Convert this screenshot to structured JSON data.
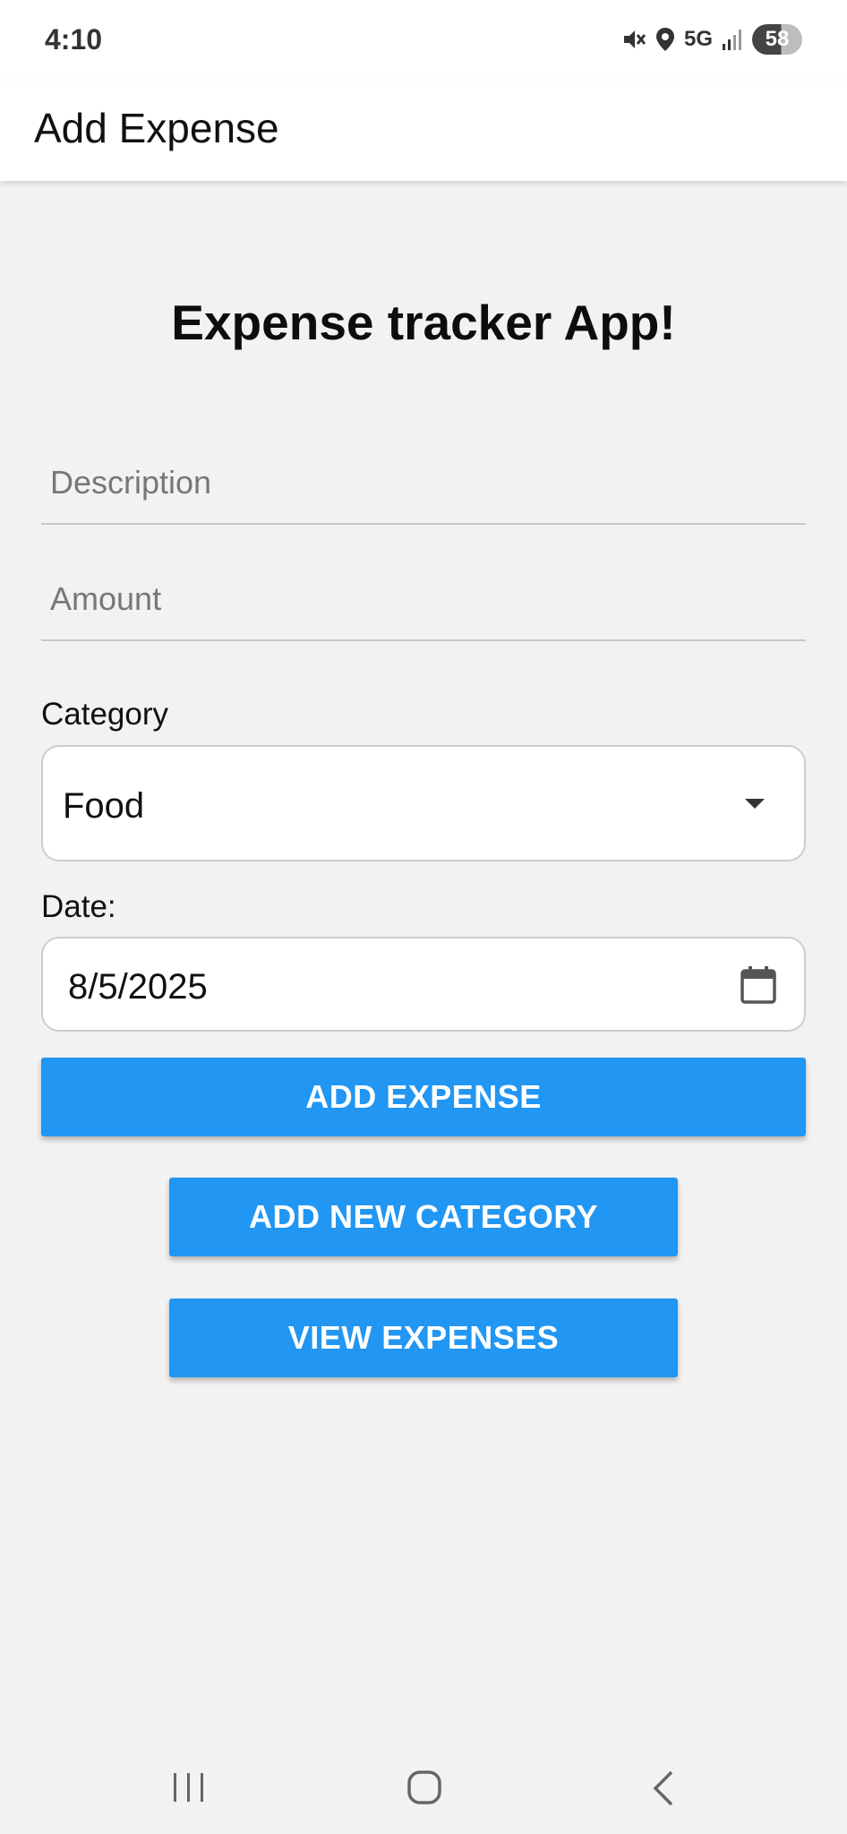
{
  "status_bar": {
    "time": "4:10",
    "network": "5G",
    "battery": "58",
    "icons": [
      "mute-icon",
      "location-icon",
      "signal-icon"
    ]
  },
  "app_bar": {
    "title": "Add Expense"
  },
  "heading": "Expense tracker App!",
  "form": {
    "description_placeholder": "Description",
    "amount_placeholder": "Amount",
    "category_label": "Category",
    "category_value": "Food",
    "date_label": "Date:",
    "date_value": "8/5/2025"
  },
  "buttons": {
    "add_expense": "ADD EXPENSE",
    "add_category": "ADD NEW CATEGORY",
    "view_expenses": "VIEW EXPENSES"
  },
  "colors": {
    "accent": "#2196f3",
    "background": "#f2f2f2",
    "surface": "#ffffff"
  }
}
